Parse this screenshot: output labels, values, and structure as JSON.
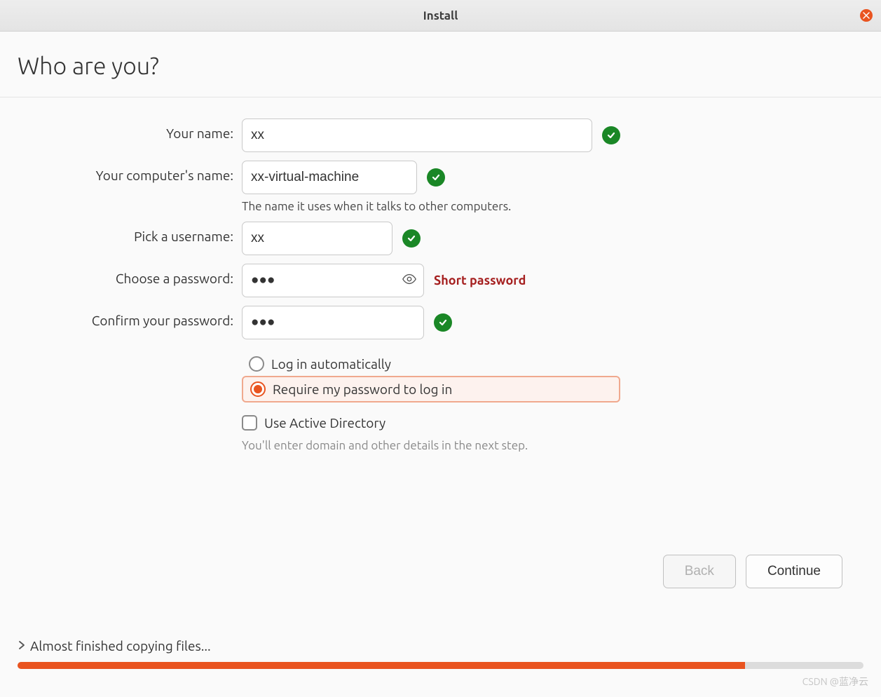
{
  "window": {
    "title": "Install"
  },
  "page": {
    "heading": "Who are you?"
  },
  "form": {
    "name": {
      "label": "Your name:",
      "value": "xx"
    },
    "computer": {
      "label": "Your computer's name:",
      "value": "xx-virtual-machine",
      "helper": "The name it uses when it talks to other computers."
    },
    "username": {
      "label": "Pick a username:",
      "value": "xx"
    },
    "password": {
      "label": "Choose a password:",
      "value": "●●●",
      "warning": "Short password"
    },
    "confirm": {
      "label": "Confirm your password:",
      "value": "●●●"
    },
    "login_options": {
      "auto": "Log in automatically",
      "require": "Require my password to log in"
    },
    "active_directory": {
      "label": "Use Active Directory",
      "helper": "You'll enter domain and other details in the next step."
    }
  },
  "buttons": {
    "back": "Back",
    "continue": "Continue"
  },
  "status": {
    "text": "Almost finished copying files...",
    "progress_percent": 86
  },
  "watermark": "CSDN @蓝净云"
}
